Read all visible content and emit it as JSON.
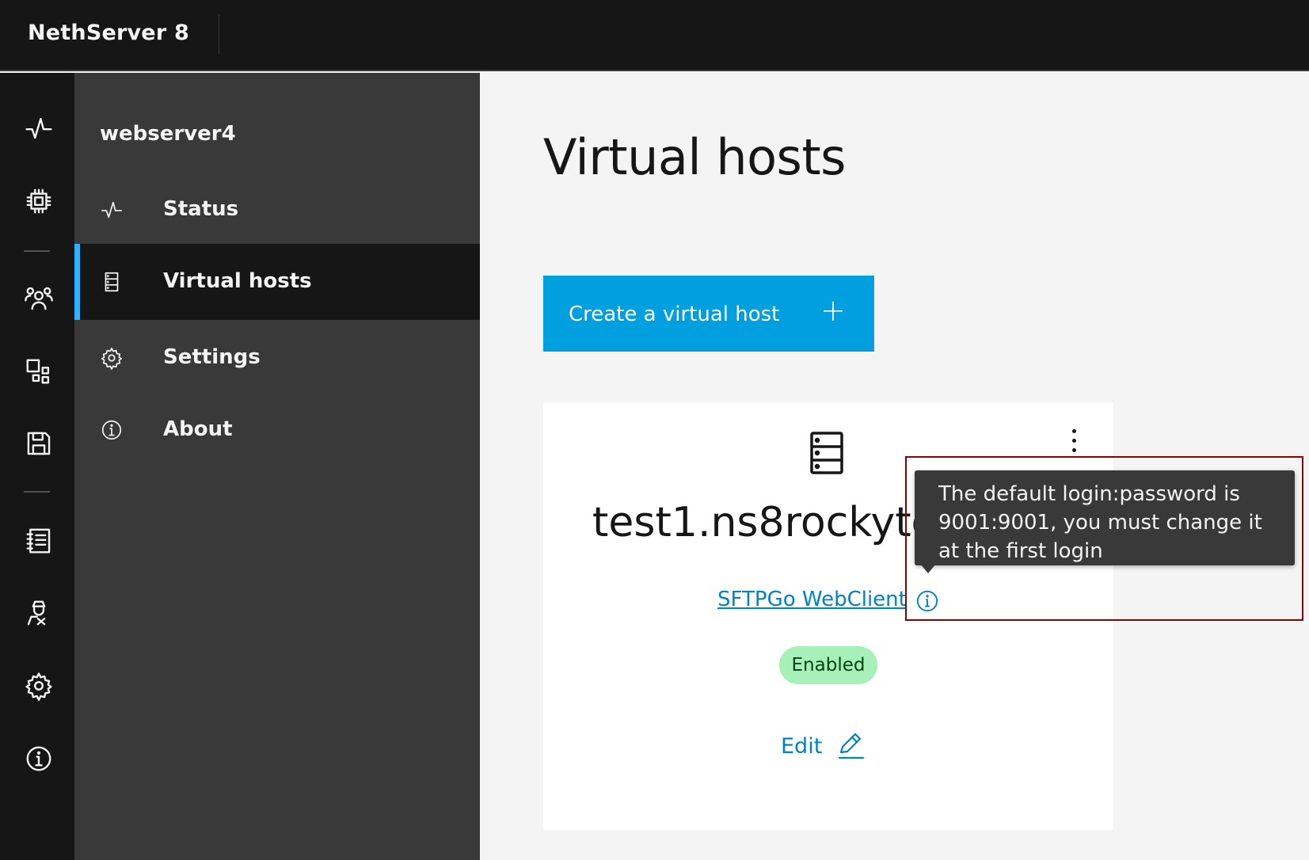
{
  "header": {
    "brand": "NethServer 8"
  },
  "sidebar": {
    "title": "webserver4",
    "items": [
      {
        "label": "Status",
        "icon": "activity-icon"
      },
      {
        "label": "Virtual hosts",
        "icon": "server-icon",
        "active": true
      },
      {
        "label": "Settings",
        "icon": "gear-icon"
      },
      {
        "label": "About",
        "icon": "info-icon"
      }
    ]
  },
  "main": {
    "title": "Virtual hosts",
    "create_button": "Create a virtual host",
    "create_button_icon": "+",
    "card": {
      "host_name": "test1.ns8rockytest",
      "link": "SFTPGo WebClient",
      "status": "Enabled",
      "edit_label": "Edit"
    }
  },
  "tooltip": {
    "text": "The default login:password is 9001:9001, you must change it at the first login"
  },
  "colors": {
    "accent": "#009fdf",
    "link": "#0082c8",
    "active_indicator": "#33b1ff",
    "badge_bg": "#a7f0ba",
    "tooltip_bg": "#393939",
    "highlight": "#8b0000"
  }
}
